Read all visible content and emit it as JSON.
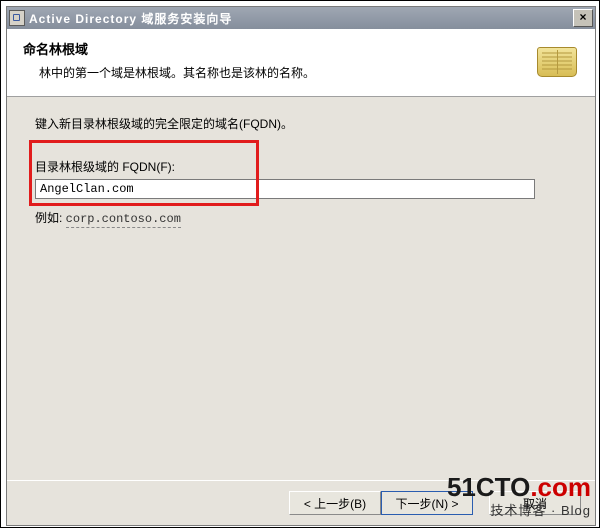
{
  "window": {
    "title": "Active Directory 域服务安装向导"
  },
  "header": {
    "heading": "命名林根域",
    "subheading": "林中的第一个域是林根域。其名称也是该林的名称。"
  },
  "body": {
    "instruction": "键入新目录林根级域的完全限定的域名(FQDN)。",
    "field_label": "目录林根级域的 FQDN(F):",
    "fqdn_value": "AngelClan.com",
    "example_prefix": "例如: ",
    "example_value": "corp.contoso.com"
  },
  "footer": {
    "back": "< 上一步(B)",
    "next": "下一步(N) >",
    "cancel": "取消"
  },
  "watermark": {
    "brand_left": "51CTO",
    "brand_right": ".com",
    "tagline_cn": "技术博客",
    "tagline_en": " · Blog"
  }
}
